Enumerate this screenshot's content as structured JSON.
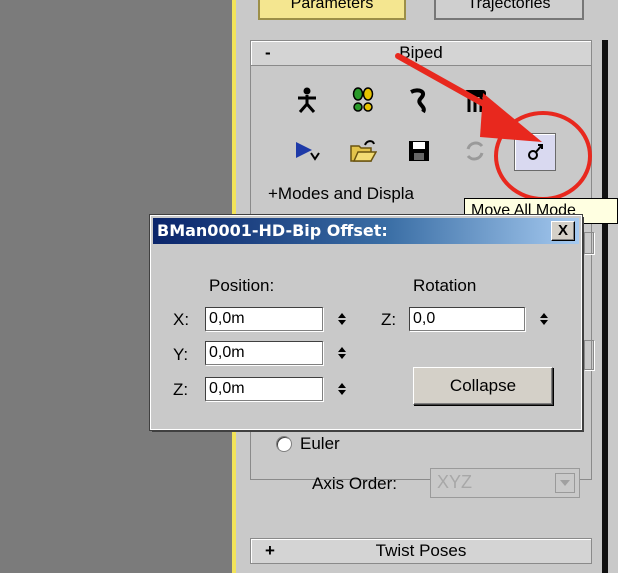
{
  "tabs": {
    "parameters": "Parameters",
    "trajectories": "Trajectories"
  },
  "biped_rollout": {
    "sign": "-",
    "title": "Biped"
  },
  "modes_label": "+Modes and Displa",
  "tooltip": "Move All Mode",
  "dialog": {
    "title": "BMan0001-HD-Bip Offset:",
    "close": "X",
    "position_header": "Position:",
    "rotation_header": "Rotation",
    "x_label": "X:",
    "x_value": "0,0m",
    "y_label": "Y:",
    "y_value": "0,0m",
    "z_label": "Z:",
    "z_value": "0,0m",
    "rot_z_label": "Z:",
    "rot_z_value": "0,0",
    "collapse_label": "Collapse"
  },
  "euler": {
    "label": "Euler"
  },
  "axis_order": {
    "label": "Axis Order:",
    "value": "XYZ"
  },
  "twist_rollout": {
    "sign": "+",
    "title": "Twist Poses"
  },
  "colors": {
    "annotation": "#e8281e",
    "panel": "#c9c9c9",
    "tooltip_bg": "#ffffe1",
    "title_bar": "#0a246a"
  },
  "icons": [
    "figure-mode-icon",
    "footstep-mode-icon",
    "motion-flow-icon",
    "mixer-mode-icon",
    "play-biped-icon",
    "load-file-icon",
    "save-file-icon",
    "convert-icon",
    "move-all-mode-icon"
  ]
}
